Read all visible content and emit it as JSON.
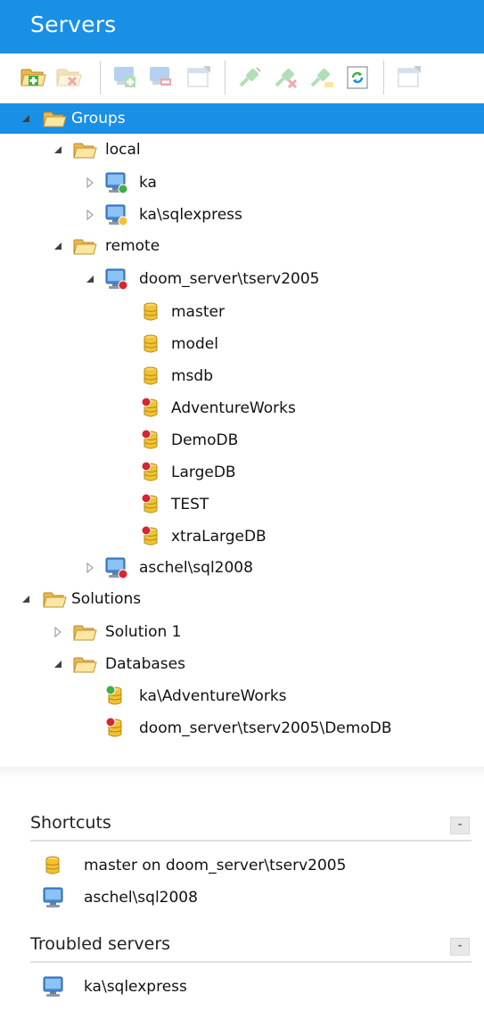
{
  "header": {
    "title": "Servers"
  },
  "toolbar": {
    "buttons": [
      {
        "name": "add-group-button",
        "icon": "folder-add-icon",
        "enabled": true
      },
      {
        "name": "remove-group-button",
        "icon": "folder-remove-icon",
        "enabled": false
      },
      {
        "name": "add-server-button",
        "icon": "server-add-icon",
        "enabled": false
      },
      {
        "name": "remove-server-button",
        "icon": "server-remove-icon",
        "enabled": false
      },
      {
        "name": "properties-button",
        "icon": "properties-icon",
        "enabled": false
      },
      {
        "name": "connect-button",
        "icon": "connect-icon",
        "enabled": false
      },
      {
        "name": "disconnect-button",
        "icon": "disconnect-icon",
        "enabled": false
      },
      {
        "name": "reconnect-button",
        "icon": "reconnect-icon",
        "enabled": false
      },
      {
        "name": "refresh-button",
        "icon": "refresh-icon",
        "enabled": true
      },
      {
        "name": "options-button",
        "icon": "options-icon",
        "enabled": false
      }
    ]
  },
  "tree": {
    "groups": "Groups",
    "local": "local",
    "ka": "ka",
    "ka_sqlexpress": "ka\\sqlexpress",
    "remote": "remote",
    "doom_server": "doom_server\\tserv2005",
    "master": "master",
    "model": "model",
    "msdb": "msdb",
    "adventureworks": "AdventureWorks",
    "demodb": "DemoDB",
    "largedb": "LargeDB",
    "test": "TEST",
    "xtralargedb": "xtraLargeDB",
    "aschel": "aschel\\sql2008",
    "solutions": "Solutions",
    "solution1": "Solution 1",
    "databases": "Databases",
    "ka_adventureworks": "ka\\AdventureWorks",
    "doom_demodb": "doom_server\\tserv2005\\DemoDB"
  },
  "shortcuts": {
    "title": "Shortcuts",
    "collapse": "-",
    "items": [
      "master on doom_server\\tserv2005",
      "aschel\\sql2008"
    ]
  },
  "troubled": {
    "title": "Troubled servers",
    "collapse": "-",
    "items": [
      "ka\\sqlexpress"
    ]
  },
  "colors": {
    "accent": "#1a8fe6",
    "folder": "#f5d27a",
    "database": "#f2c230",
    "status_ok": "#3cb043",
    "status_error": "#d9262c"
  }
}
